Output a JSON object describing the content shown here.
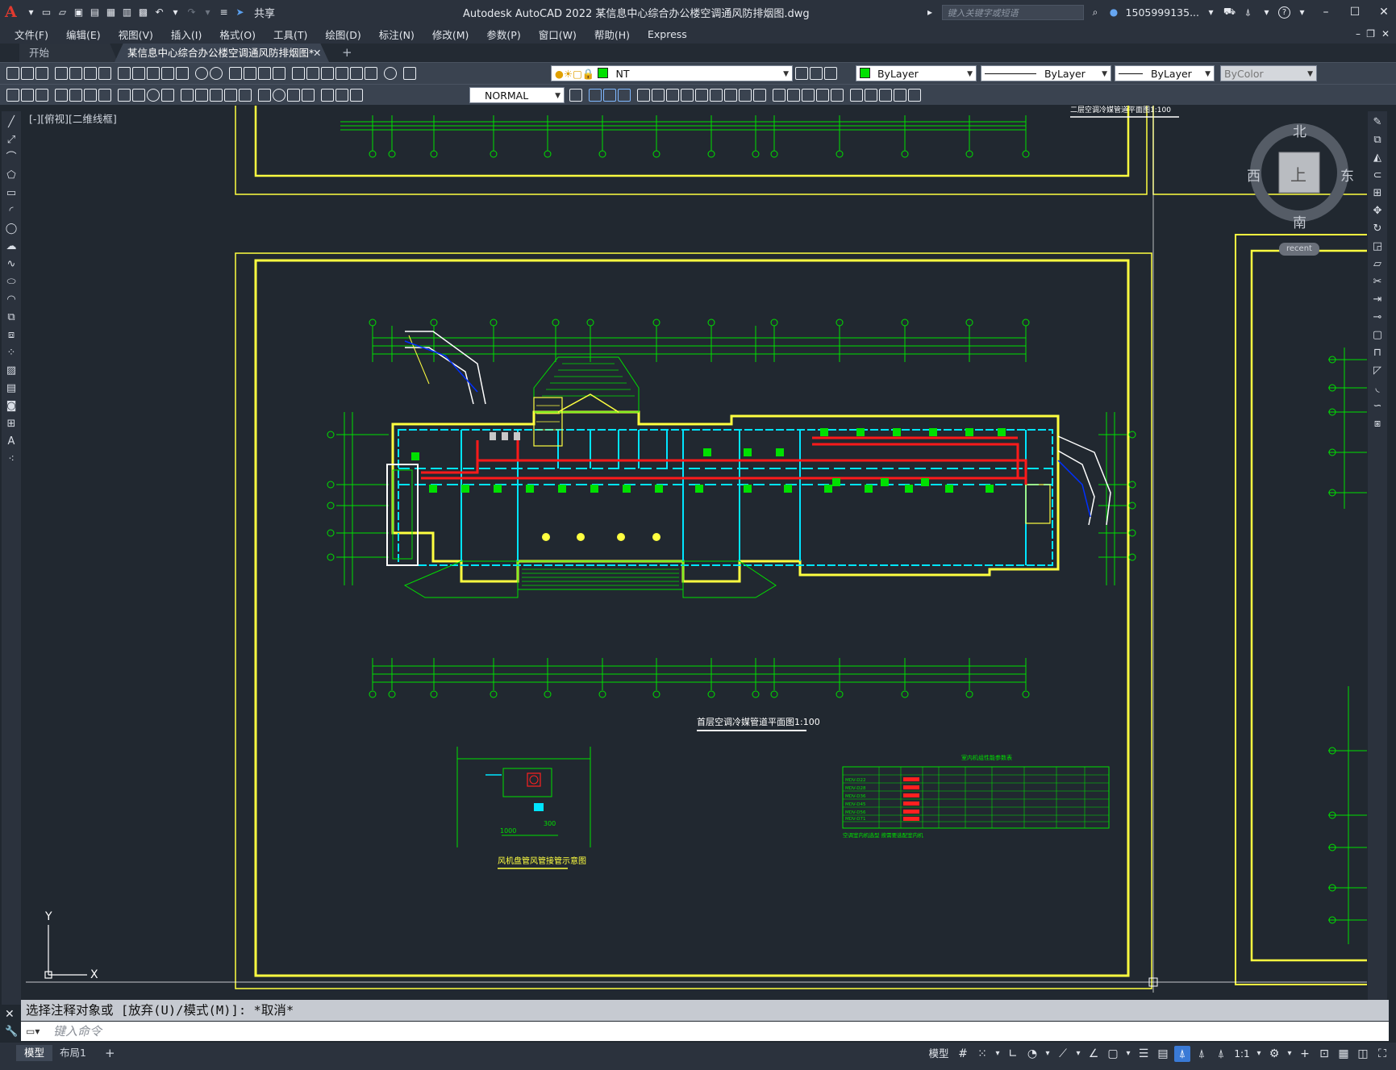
{
  "app": {
    "logo": "A",
    "window_title": "Autodesk AutoCAD 2022    某信息中心综合办公楼空调通风防排烟图.dwg",
    "share_label": "共享",
    "search_placeholder": "键入关键字或短语",
    "user": "1505999135...",
    "help": "?"
  },
  "menu": [
    "文件(F)",
    "编辑(E)",
    "视图(V)",
    "插入(I)",
    "格式(O)",
    "工具(T)",
    "绘图(D)",
    "标注(N)",
    "修改(M)",
    "参数(P)",
    "窗口(W)",
    "帮助(H)",
    "Express"
  ],
  "tabs": {
    "start": "开始",
    "document": "某信息中心综合办公楼空调通风防排烟图*",
    "close": "✕",
    "add": "+"
  },
  "toolbar1": {
    "layer": "NT",
    "color": "ByLayer",
    "linetype": "ByLayer",
    "lineweight": "ByLayer",
    "plotstyle": "ByColor"
  },
  "toolbar2": {
    "textstyle": "NORMAL"
  },
  "viewport": {
    "label": "[-][俯视][二维线框]",
    "ucs_x": "X",
    "ucs_y": "Y"
  },
  "viewcube": {
    "north": "北",
    "south": "南",
    "east": "东",
    "west": "西",
    "face": "上",
    "recent": "recent"
  },
  "drawing": {
    "title_main": "首层空调冷媒管道平面图1:100",
    "title_top": "二层空调冷媒管道平面图1:100",
    "detail_title": "风机盘管风管接管示意图",
    "detail_dims": [
      "1000",
      "300"
    ],
    "table_title": "室内机组性能参数表",
    "table_note": "空调室内机选型 按需要选配室内机",
    "table_rows": [
      "MDV-D22",
      "MDV-D28",
      "MDV-D36",
      "MDV-D45",
      "MDV-D56",
      "MDV-D71"
    ]
  },
  "command": {
    "history": "选择注释对象或 [放弃(U)/模式(M)]: *取消*",
    "placeholder": "键入命令"
  },
  "status": {
    "model_tab": "模型",
    "layout_tab": "布局1",
    "add": "+",
    "model_btn": "模型",
    "scale": "1:1"
  }
}
